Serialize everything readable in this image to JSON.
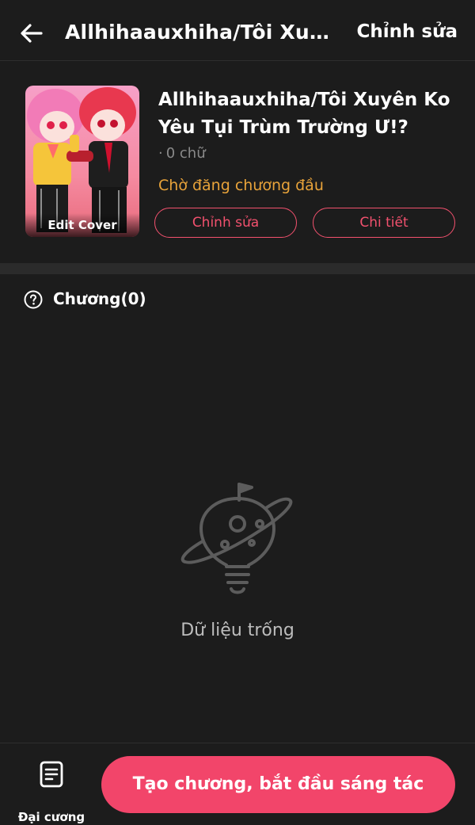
{
  "header": {
    "title": "Allhihaauxhiha/Tôi Xuyên...",
    "edit_label": "Chỉnh sửa"
  },
  "story": {
    "title": "Allhihaauxhiha/Tôi Xuyên Ko Yêu Tụi Trùm Trường Ư!?",
    "word_count": "0 chữ",
    "status": "Chờ đăng chương đầu",
    "cover_label": "Edit Cover",
    "edit_button": "Chỉnh sửa",
    "detail_button": "Chi tiết"
  },
  "chapters": {
    "label": "Chương(0)",
    "empty_text": "Dữ liệu trống"
  },
  "bottom": {
    "outline_label": "Đại cương",
    "create_button": "Tạo chương, bắt đầu sáng tác"
  },
  "colors": {
    "background": "#1c1c1c",
    "accent": "#f2456a",
    "status": "#e8a33a"
  }
}
